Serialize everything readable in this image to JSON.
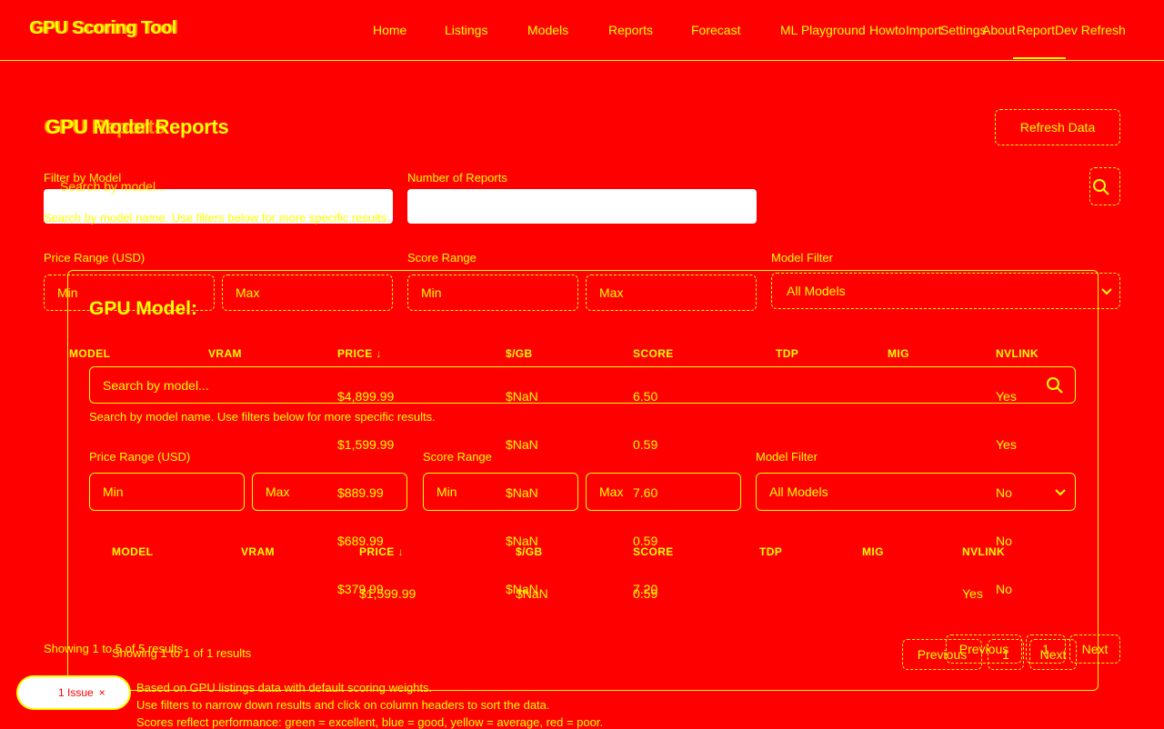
{
  "app": {
    "brand": "GPU Scoring Tool",
    "brand_ghost": "GPU Scoring Tool"
  },
  "nav": {
    "items": [
      {
        "label": "Home"
      },
      {
        "label": "Listings"
      },
      {
        "label": "Models"
      },
      {
        "label": "Reports"
      },
      {
        "label": "Forecast"
      },
      {
        "label": "ML Playground"
      },
      {
        "label": "Howto"
      },
      {
        "label": "Import"
      },
      {
        "label": "Settings"
      },
      {
        "label": "About"
      },
      {
        "label": "Report"
      },
      {
        "label": "Dev Refresh"
      }
    ]
  },
  "page": {
    "title": "GPU Model Reports",
    "title_overlap": "GPU Reports",
    "refresh_button": "Refresh Data",
    "refresh_ghost": "Refresh",
    "filter_by_model_label": "Filter by Model",
    "search_placeholder": "Search by model...",
    "search_help": "Search by model name. Use filters below for more specific results.",
    "number_of_reports_label": "Number of Reports",
    "price_range_label": "Price Range (USD)",
    "score_range_label": "Score Range",
    "model_filter_label": "Model Filter",
    "min_placeholder": "Min",
    "max_placeholder": "Max",
    "model_filter_value": "All Models",
    "showing_text": "Showing 1 to 5 of 5 results",
    "showing_text_ghost": "Showing 1 to 5 of 5 results",
    "previous_button": "Previous",
    "page_number": "1",
    "next_button": "Next",
    "footer_lines": [
      "Based on GPU listings data with default scoring weights.",
      "Use filters to narrow down results and click on column headers to sort the data.",
      "Scores reflect performance: green = excellent, blue = good, yellow = average, red = poor."
    ],
    "columns": [
      "MODEL",
      "VRAM",
      "PRICE ↓",
      "$/GB",
      "SCORE",
      "TDP",
      "MIG",
      "NVLINK"
    ],
    "rows": [
      {
        "price": "$4,899.99",
        "per_gb": "$NaN",
        "score": "6.50",
        "nvlink": "Yes"
      },
      {
        "price": "$1,599.99",
        "per_gb": "$NaN",
        "score": "0.59",
        "nvlink": "Yes"
      },
      {
        "price": "$889.99",
        "per_gb": "$NaN",
        "score": "7.60",
        "nvlink": "No"
      },
      {
        "price": "$689.99",
        "per_gb": "$NaN",
        "score": "0.59",
        "nvlink": "No"
      },
      {
        "price": "$379.99",
        "per_gb": "$NaN",
        "score": "7.20",
        "nvlink": "No"
      }
    ]
  },
  "modal": {
    "title": "GPU Model:",
    "search_placeholder": "Search by model...",
    "search_help": "Search by model name. Use filters below for more specific results.",
    "price_range_label": "Price Range (USD)",
    "score_range_label": "Score Range",
    "model_filter_label": "Model Filter",
    "min_placeholder": "Min",
    "max_placeholder": "Max",
    "model_filter_value": "All Models",
    "columns": [
      "MODEL",
      "VRAM",
      "PRICE ↓",
      "$/GB",
      "SCORE",
      "TDP",
      "MIG",
      "NVLINK"
    ],
    "row": {
      "price": "$1,599.99",
      "per_gb": "$NaN",
      "score": "0.59",
      "nvlink": "Yes"
    },
    "showing_text": "Showing 1 to 1 of 1 results",
    "previous_button": "Previous",
    "page_number": "1",
    "next_button": "Next"
  },
  "issues": {
    "label": "1 Issue",
    "close": "×"
  },
  "colors": {
    "background": "#ff0000",
    "foreground": "#ffff00",
    "input_fill": "#ffffff"
  }
}
